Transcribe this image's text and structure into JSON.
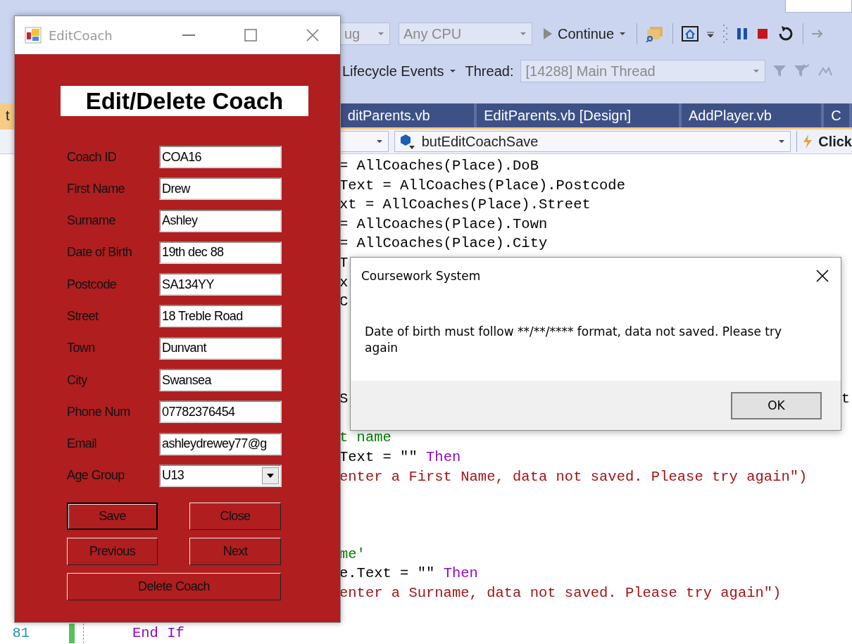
{
  "ide": {
    "toolbar": {
      "config_dropdown": "ug",
      "platform_dropdown": "Any CPU",
      "continue_button": "Continue"
    },
    "debug_bar": {
      "lifecycle_events": "Lifecycle Events",
      "thread_label": "Thread:",
      "thread_dropdown": "[14288] Main Thread"
    },
    "tabs": [
      {
        "label": "t",
        "selected": true
      },
      {
        "label": "ditParents.vb",
        "selected": false
      },
      {
        "label": "EditParents.vb [Design]",
        "selected": false
      },
      {
        "label": "AddPlayer.vb",
        "selected": false
      },
      {
        "label": "C",
        "selected": false
      }
    ],
    "nav_bar": {
      "member_dropdown": "butEditCoachSave",
      "event": "Click"
    },
    "code_lines": [
      {
        "tokens": [
          {
            "text": "= AllCoaches(Place).DoB",
            "kind": "plain"
          }
        ]
      },
      {
        "tokens": [
          {
            "text": "Text = AllCoaches(Place).Postcode",
            "kind": "plain"
          }
        ]
      },
      {
        "tokens": [
          {
            "text": "xt = AllCoaches(Place).Street",
            "kind": "plain"
          }
        ]
      },
      {
        "tokens": [
          {
            "text": "= AllCoaches(Place).Town",
            "kind": "plain"
          }
        ]
      },
      {
        "tokens": [
          {
            "text": "= AllCoaches(Place).City",
            "kind": "plain"
          }
        ]
      },
      {
        "tokens": [
          {
            "text": "T",
            "kind": "plain"
          }
        ]
      },
      {
        "tokens": [
          {
            "text": "x",
            "kind": "plain"
          }
        ]
      },
      {
        "tokens": [
          {
            "text": "C",
            "kind": "plain"
          }
        ]
      },
      {
        "tokens": [
          {
            "text": "S",
            "kind": "plain"
          }
        ],
        "tail": [
          {
            "text": "t",
            "kind": "plain"
          }
        ]
      },
      {
        "tokens": [
          {
            "text": "t name",
            "kind": "comment"
          }
        ]
      },
      {
        "tokens": [
          {
            "text": "Text = \"\" ",
            "kind": "plain"
          },
          {
            "text": "Then",
            "kind": "keyword"
          }
        ]
      },
      {
        "tokens": [
          {
            "text": "enter a First Name, data not saved. Please try again\")",
            "kind": "string"
          }
        ]
      },
      {
        "tokens": [
          {
            "text": "me'",
            "kind": "comment"
          }
        ]
      },
      {
        "tokens": [
          {
            "text": "e.Text = \"\" ",
            "kind": "plain"
          },
          {
            "text": "Then",
            "kind": "keyword"
          }
        ]
      },
      {
        "tokens": [
          {
            "text": "enter a Surname, data not saved. Please try again\")",
            "kind": "string"
          }
        ]
      }
    ],
    "last_line": {
      "number": "81",
      "changed": true,
      "tokens": [
        {
          "text": "End If",
          "kind": "keyword"
        }
      ]
    }
  },
  "edit_coach": {
    "title": "EditCoach",
    "heading": "Edit/Delete Coach",
    "fields": [
      {
        "label": "Coach ID",
        "value": "COA16",
        "kind": "text"
      },
      {
        "label": "First Name",
        "value": "Drew",
        "kind": "text"
      },
      {
        "label": "Surname",
        "value": "Ashley",
        "kind": "text"
      },
      {
        "label": "Date of Birth",
        "value": "19th dec 88",
        "kind": "text"
      },
      {
        "label": "Postcode",
        "value": "SA134YY",
        "kind": "text"
      },
      {
        "label": "Street",
        "value": "18 Treble Road",
        "kind": "text"
      },
      {
        "label": "Town",
        "value": "Dunvant",
        "kind": "text"
      },
      {
        "label": "City",
        "value": "Swansea",
        "kind": "text"
      },
      {
        "label": "Phone Num",
        "value": "07782376454",
        "kind": "text"
      },
      {
        "label": "Email",
        "value": "ashleydrewey77@g",
        "kind": "text"
      },
      {
        "label": "Age Group",
        "value": "U13",
        "kind": "dropdown"
      }
    ],
    "buttons": [
      {
        "label": "Save",
        "default": true
      },
      {
        "label": "Close",
        "default": false
      },
      {
        "label": "Previous",
        "default": false
      },
      {
        "label": "Next",
        "default": false
      },
      {
        "label": "Delete Coach",
        "default": false
      }
    ]
  },
  "message_box": {
    "title": "Coursework System",
    "message": "Date of birth must follow **/**/**** format, data not saved. Please try again",
    "button": "OK"
  }
}
